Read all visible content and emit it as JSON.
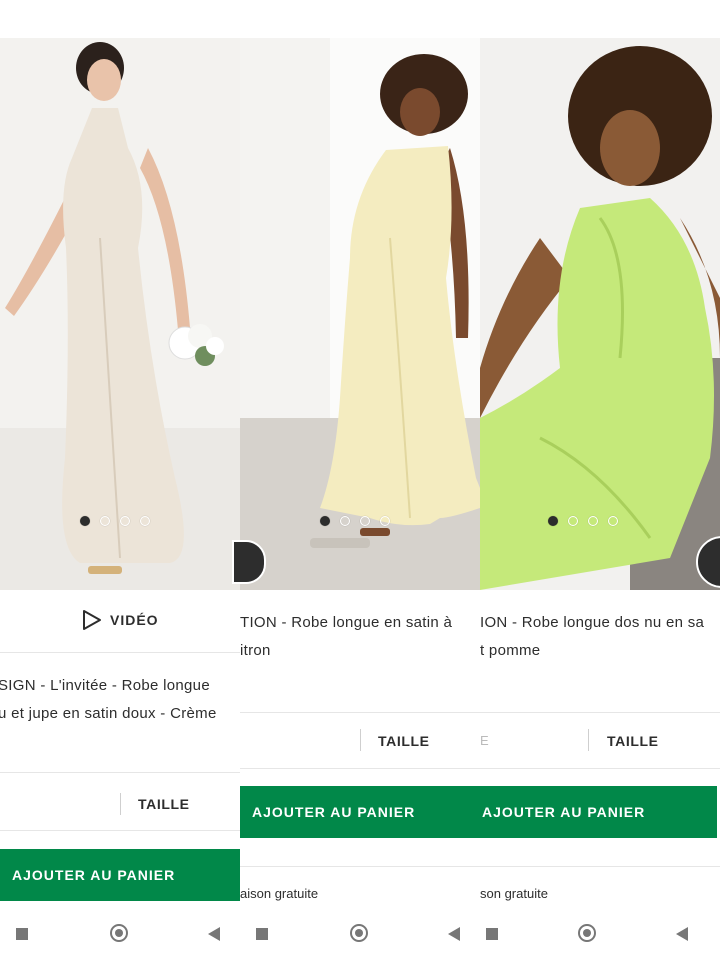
{
  "colors": {
    "brand_green": "#018849",
    "text": "#2d2d2d",
    "divider": "#e6e6e6",
    "dress_ivory": "#ece4d8",
    "dress_lemon": "#f4ecc0",
    "dress_apple": "#c5e97a"
  },
  "panels": [
    {
      "video_label": "VIDÉO",
      "title_line1": "SIGN - L'invitée - Robe longue ",
      "title_line2": "u et jupe en satin doux - Crème",
      "size_label": "TAILLE",
      "add_to_cart": "AJOUTER AU PANIER",
      "carousel": {
        "count": 4,
        "active": 1
      }
    },
    {
      "title_line1": "TION - Robe longue en satin à",
      "title_line2": "itron",
      "size_label": "TAILLE",
      "add_to_cart": "AJOUTER AU PANIER",
      "shipping": "aison gratuite",
      "carousel": {
        "count": 4,
        "active": 1
      }
    },
    {
      "title_line1": "ION - Robe longue dos nu en sa",
      "title_line2": "t pomme",
      "color_stub": "E",
      "size_label": "TAILLE",
      "add_to_cart": "AJOUTER AU PANIER",
      "shipping": "son gratuite",
      "carousel": {
        "count": 4,
        "active": 1
      }
    }
  ],
  "system_nav": {
    "recents_icon": "square-icon",
    "home_icon": "home-circle-icon",
    "back_icon": "back-triangle-icon"
  }
}
